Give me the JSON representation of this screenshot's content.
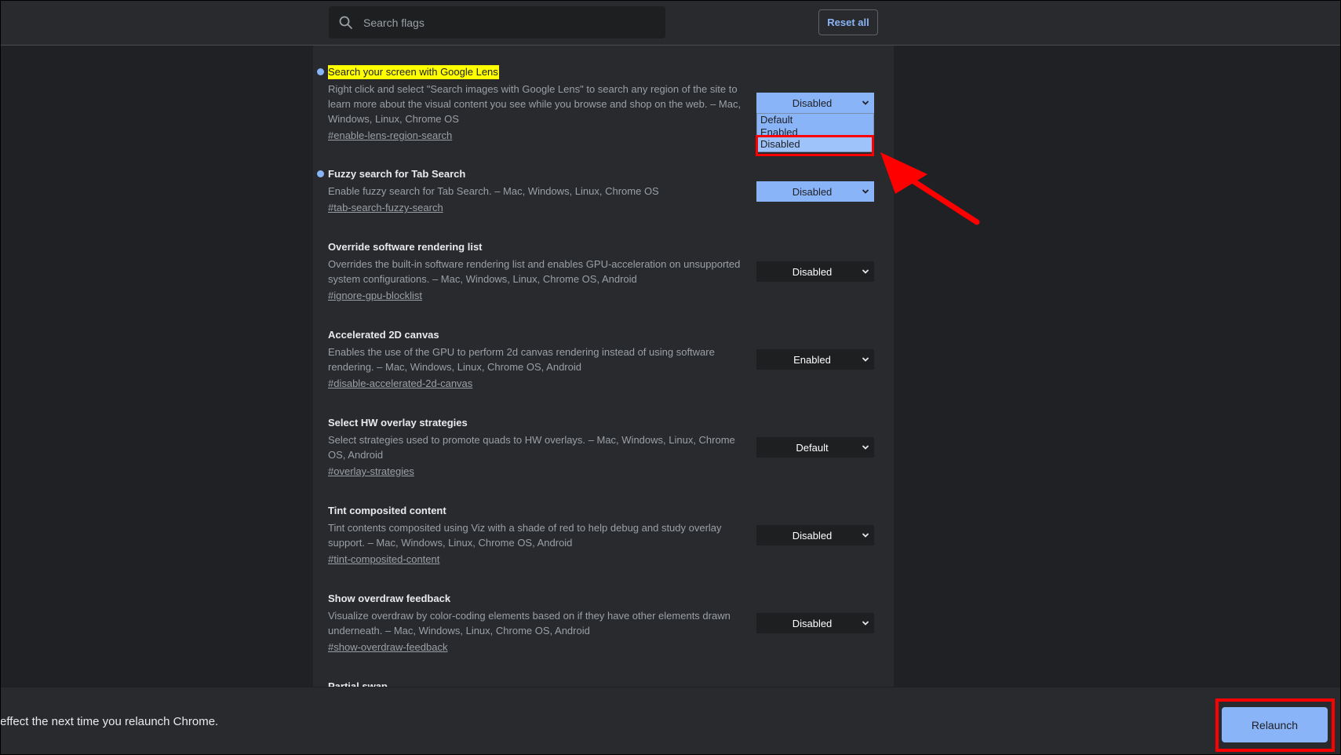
{
  "header": {
    "search": {
      "placeholder": "Search flags",
      "value": ""
    },
    "reset_label": "Reset all"
  },
  "flags": [
    {
      "title": "Search your screen with Google Lens",
      "description": "Right click and select \"Search images with Google Lens\" to search any region of the site to learn more about the visual content you see while you browse and shop on the web. – Mac, Windows, Linux, Chrome OS",
      "anchor": "#enable-lens-region-search",
      "value": "Disabled",
      "modified": true,
      "highlighted": true,
      "dropdown_open": true,
      "options": [
        "Default",
        "Enabled",
        "Disabled"
      ],
      "hovered_option": "Disabled"
    },
    {
      "title": "Fuzzy search for Tab Search",
      "description": "Enable fuzzy search for Tab Search. – Mac, Windows, Linux, Chrome OS",
      "anchor": "#tab-search-fuzzy-search",
      "value": "Disabled",
      "modified": true
    },
    {
      "title": "Override software rendering list",
      "description": "Overrides the built-in software rendering list and enables GPU-acceleration on unsupported system configurations. – Mac, Windows, Linux, Chrome OS, Android",
      "anchor": "#ignore-gpu-blocklist",
      "value": "Disabled",
      "modified": false
    },
    {
      "title": "Accelerated 2D canvas",
      "description": "Enables the use of the GPU to perform 2d canvas rendering instead of using software rendering. – Mac, Windows, Linux, Chrome OS, Android",
      "anchor": "#disable-accelerated-2d-canvas",
      "value": "Enabled",
      "modified": false
    },
    {
      "title": "Select HW overlay strategies",
      "description": "Select strategies used to promote quads to HW overlays. – Mac, Windows, Linux, Chrome OS, Android",
      "anchor": "#overlay-strategies",
      "value": "Default",
      "modified": false
    },
    {
      "title": "Tint composited content",
      "description": "Tint contents composited using Viz with a shade of red to help debug and study overlay support. – Mac, Windows, Linux, Chrome OS, Android",
      "anchor": "#tint-composited-content",
      "value": "Disabled",
      "modified": false
    },
    {
      "title": "Show overdraw feedback",
      "description": "Visualize overdraw by color-coding elements based on if they have other elements drawn underneath. – Mac, Windows, Linux, Chrome OS, Android",
      "anchor": "#show-overdraw-feedback",
      "value": "Disabled",
      "modified": false
    },
    {
      "title": "Partial swap"
    }
  ],
  "footer": {
    "message": "effect the next time you relaunch Chrome.",
    "relaunch_label": "Relaunch"
  },
  "colors": {
    "accent": "#8ab4f8",
    "highlight": "#ffff00",
    "annotation": "#ff0000",
    "background": "#202124",
    "surface": "#292a2d"
  }
}
